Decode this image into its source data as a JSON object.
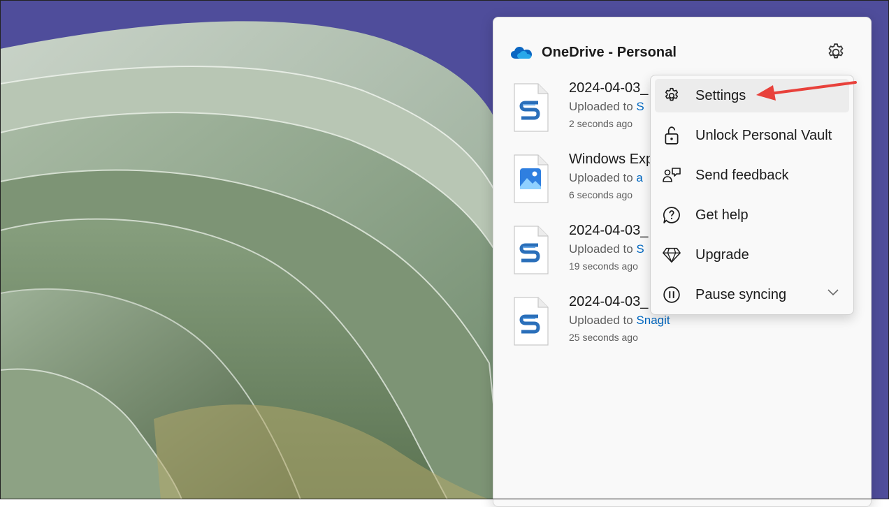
{
  "header": {
    "title": "OneDrive - Personal",
    "cloud_icon": "onedrive-cloud-icon",
    "settings_icon": "gear-icon"
  },
  "files": [
    {
      "name": "2024-04-03_",
      "status_prefix": "Uploaded to ",
      "status_link": "S",
      "time": "2 seconds ago",
      "icon": "snagit-file-icon"
    },
    {
      "name": "Windows Exp",
      "status_prefix": "Uploaded to ",
      "status_link": "a",
      "time": "6 seconds ago",
      "icon": "image-file-icon"
    },
    {
      "name": "2024-04-03_",
      "status_prefix": "Uploaded to ",
      "status_link": "S",
      "time": "19 seconds ago",
      "icon": "snagit-file-icon"
    },
    {
      "name": "2024-04-03_",
      "status_prefix": "Uploaded to ",
      "status_link": "Snagit",
      "time": "25 seconds ago",
      "icon": "snagit-file-icon"
    }
  ],
  "menu": {
    "items": [
      {
        "label": "Settings",
        "icon": "gear-icon"
      },
      {
        "label": "Unlock Personal Vault",
        "icon": "unlock-icon"
      },
      {
        "label": "Send feedback",
        "icon": "feedback-icon"
      },
      {
        "label": "Get help",
        "icon": "help-icon"
      },
      {
        "label": "Upgrade",
        "icon": "diamond-icon"
      },
      {
        "label": "Pause syncing",
        "icon": "pause-icon"
      }
    ]
  },
  "colors": {
    "accent": "#0067c0",
    "annotation_arrow": "#e8413b",
    "desktop_background": "#4e4c9a"
  }
}
